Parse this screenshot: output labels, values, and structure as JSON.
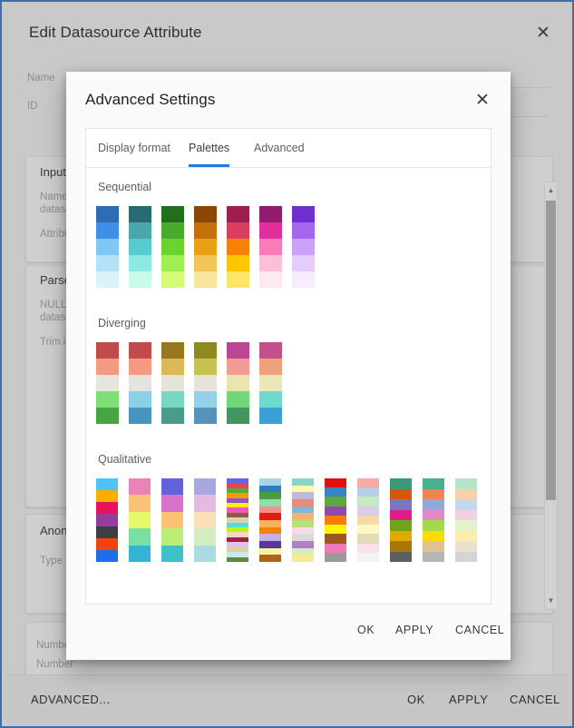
{
  "background_dialog": {
    "title": "Edit Datasource Attribute",
    "close_icon": "close-icon",
    "fields": [
      {
        "label": "Name"
      },
      {
        "label": "ID"
      }
    ],
    "cards": [
      {
        "title": "Input",
        "lines": [
          "Name i",
          "dataso"
        ],
        "sub": "Attribu"
      },
      {
        "title": "Parse",
        "lines": [
          "NULL v",
          "dataso"
        ],
        "sub": "Trim in"
      },
      {
        "title": "Anony",
        "lines": [
          "Type"
        ],
        "sub": ""
      }
    ],
    "number_lines": [
      "Number",
      "Number"
    ],
    "buttons": {
      "advanced": "ADVANCED...",
      "ok": "OK",
      "apply": "APPLY",
      "cancel": "CANCEL"
    },
    "scrollbar": {
      "up_icon": "scroll-up-icon",
      "down_icon": "scroll-down-icon"
    }
  },
  "modal": {
    "title": "Advanced Settings",
    "close_icon": "close-icon",
    "tabs": [
      {
        "label": "Display format",
        "active": false
      },
      {
        "label": "Palettes",
        "active": true
      },
      {
        "label": "Advanced",
        "active": false
      }
    ],
    "buttons": {
      "ok": "OK",
      "apply": "APPLY",
      "cancel": "CANCEL"
    },
    "sections": [
      {
        "name": "Sequential",
        "palettes": [
          [
            "#2e6db4",
            "#3f8fe8",
            "#7ec8f5",
            "#b3e1f7",
            "#daf3fb"
          ],
          [
            "#296b72",
            "#4aa6ac",
            "#58cbd0",
            "#8ceae3",
            "#c8fbe9"
          ],
          [
            "#226e1c",
            "#4aaa2b",
            "#6ad32f",
            "#a0ef52",
            "#d6fb7a"
          ],
          [
            "#8b4708",
            "#c3700a",
            "#eaa013",
            "#f2c456",
            "#f8e49a"
          ],
          [
            "#9c1f4d",
            "#db3e5e",
            "#f58207",
            "#ffc500",
            "#ffe566"
          ],
          [
            "#931b6e",
            "#e32f9c",
            "#f97bb8",
            "#fbc0d8",
            "#fce9f0"
          ],
          [
            "#7030d0",
            "#a565ef",
            "#c9a2fb",
            "#e4ccfd",
            "#f6ecfe"
          ]
        ]
      },
      {
        "name": "Diverging",
        "palettes": [
          [
            "#c34a4a",
            "#f49a81",
            "#e6e6dd",
            "#7ede78",
            "#45a544"
          ],
          [
            "#c34a4a",
            "#f49a81",
            "#e3e3e0",
            "#8ad0e9",
            "#4b93bf"
          ],
          [
            "#97781e",
            "#ddb858",
            "#e5e4da",
            "#77d8bf",
            "#4b9b8b"
          ],
          [
            "#8c8a20",
            "#c7c254",
            "#e6e4da",
            "#94d2e8",
            "#5593bd"
          ],
          [
            "#bc4594",
            "#f09b93",
            "#e8e5ae",
            "#72d778",
            "#41975f"
          ],
          [
            "#c3508c",
            "#f0a07c",
            "#eae8bb",
            "#71d8cd",
            "#3b9fd6"
          ]
        ]
      },
      {
        "name": "Qualitative",
        "palettes": [
          [
            "#4ec3f7",
            "#fbad00",
            "#e8115b",
            "#943d9b",
            "#3d3f46",
            "#f3430d",
            "#1d6fe8"
          ],
          [
            "#eb83b9",
            "#fbc375",
            "#e5f86a",
            "#79e0a3",
            "#35b3d5"
          ],
          [
            "#6461dd",
            "#d773c9",
            "#fbc375",
            "#bbed77",
            "#3dc3c7"
          ],
          [
            "#a7a8e0",
            "#e4bae1",
            "#fadfb9",
            "#d3edc0",
            "#a9dce0"
          ],
          [
            "#5d6ae8",
            "#e8444c",
            "#57a83f",
            "#f49a09",
            "#9454c0",
            "#fbed14",
            "#f256c0",
            "#8a6239",
            "#d8d0bb",
            "#54e0d0",
            "#b8f60e",
            "#f7d2c5",
            "#9e2349",
            "#e0c2e8",
            "#ded09a",
            "#cbe8f0",
            "#5f8a3a"
          ],
          [
            "#a8d4ea",
            "#2b7fb8",
            "#4d9c3f",
            "#8ae0a7",
            "#f29090",
            "#e01d12",
            "#f5b45a",
            "#f2810d",
            "#c0b3e2",
            "#5a3798",
            "#f7f2a2",
            "#b06218"
          ],
          [
            "#89d4c4",
            "#fbf8ae",
            "#bdb9dc",
            "#f08878",
            "#80b8db",
            "#f7b46f",
            "#b9e07a",
            "#f9dbe8",
            "#d9d9d9",
            "#b47ec8",
            "#d3ecc0",
            "#f7ea93"
          ],
          [
            "#e0100d",
            "#3b82c0",
            "#5ea93f",
            "#9548a8",
            "#f67c0b",
            "#fbf506",
            "#a0561f",
            "#f278bb",
            "#9a9a9a"
          ],
          [
            "#f6aca3",
            "#b9cce6",
            "#c8e8bf",
            "#d9cee8",
            "#f9d8a8",
            "#fcfac2",
            "#e2dabb",
            "#fbdfeb",
            "#f3f3f3"
          ],
          [
            "#3a9a7a",
            "#d45808",
            "#7878c0",
            "#e01c8b",
            "#6fa514",
            "#e0a904",
            "#a87708",
            "#5f5f5f"
          ],
          [
            "#48b08d",
            "#f08350",
            "#93a8d8",
            "#e089c5",
            "#a4d94a",
            "#fbdb07",
            "#e0c28e",
            "#b5b5b5"
          ],
          [
            "#b8e4cc",
            "#f8d0aa",
            "#c8d6ec",
            "#f2cfe2",
            "#e4f2c8",
            "#fbeeac",
            "#ece0cc",
            "#d4d4d4"
          ]
        ]
      }
    ]
  }
}
